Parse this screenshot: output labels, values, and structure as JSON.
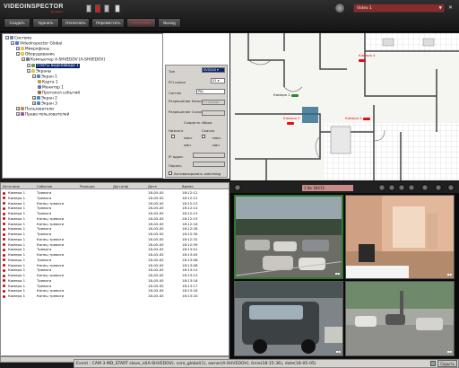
{
  "app": {
    "logo_main": "VIDEOINSPECTOR",
    "logo_sub": "GLOBAL"
  },
  "toolbar": {
    "buttons": [
      "Создать",
      "Удалить",
      "Отключить",
      "Переместить",
      "Настройки",
      "Выход"
    ],
    "active_index": 4,
    "video_select": "Video 1"
  },
  "tree": {
    "nodes": [
      {
        "label": "Система",
        "level": 0,
        "expander": "−",
        "icon": "system-icon"
      },
      {
        "label": "VideoInspector Global",
        "level": 1,
        "expander": "−",
        "icon": "server-icon"
      },
      {
        "label": "Микрофоны",
        "level": 2,
        "expander": "+",
        "icon": "folder-icon"
      },
      {
        "label": "Оборудование",
        "level": 2,
        "expander": "−",
        "icon": "folder-icon"
      },
      {
        "label": "Компьютер A-SHVEDOV [A-SHVEDOV]",
        "level": 3,
        "expander": "−",
        "icon": "computer-icon"
      },
      {
        "label": "Платы видеоввода 1",
        "level": 4,
        "expander": "−",
        "icon": "board-icon",
        "selected": true
      },
      {
        "label": "Экраны",
        "level": 4,
        "expander": "−",
        "icon": "folder-icon"
      },
      {
        "label": "Экран 1",
        "level": 5,
        "expander": "−",
        "icon": "screen-icon"
      },
      {
        "label": "Карта 1",
        "level": 6,
        "expander": "",
        "icon": "map-icon"
      },
      {
        "label": "Монитор 1",
        "level": 6,
        "expander": "",
        "icon": "monitor-icon"
      },
      {
        "label": "Протокол событий",
        "level": 6,
        "expander": "",
        "icon": "log-icon"
      },
      {
        "label": "Экран 2",
        "level": 5,
        "expander": "+",
        "icon": "screen-icon"
      },
      {
        "label": "Экран 3",
        "level": 5,
        "expander": "+",
        "icon": "screen-icon"
      },
      {
        "label": "Пользователи",
        "level": 2,
        "expander": "+",
        "icon": "users-icon"
      },
      {
        "label": "Права пользователей",
        "level": 2,
        "expander": "+",
        "icon": "rights-icon"
      }
    ]
  },
  "props": {
    "type_label": "Тип",
    "type_value": "SV5244",
    "pci_label": "PCI канал",
    "pci_value": "01",
    "signal_label": "Сигнал",
    "signal_value": "PAL",
    "res_low_label": "Разрешение Низкого",
    "res_low_value": "Стандарт",
    "res_high_label": "Разрешение Скачка",
    "res_high_value": "",
    "speed_label": "Скорость сбора",
    "low_label": "Низкого",
    "jump_label": "Скачка",
    "max_label": "макс",
    "min_label": "мин",
    "ip_label": "IP адрес",
    "password_label": "Пароль",
    "watchdog_label": "Активизировать watchdog"
  },
  "map": {
    "cameras": [
      {
        "label": "Камера 1",
        "color": "green"
      },
      {
        "label": "Камера 4",
        "color": "red"
      },
      {
        "label": "Камера 3",
        "color": "red"
      },
      {
        "label": "Камера 2",
        "color": "red"
      }
    ]
  },
  "log": {
    "columns": [
      "Источник",
      "Событие",
      "Реакция",
      "Доп.инф",
      "Дата",
      "Время"
    ],
    "rows": [
      [
        "Камера 1",
        "Тревога",
        "",
        "",
        "18-05-05",
        "18:12:12"
      ],
      [
        "Камера 1",
        "Тревога",
        "",
        "",
        "18-05-05",
        "18:12:12"
      ],
      [
        "Камера 1",
        "Конец тревоги",
        "",
        "",
        "18-05-05",
        "18:12:13"
      ],
      [
        "Камера 1",
        "Тревога",
        "",
        "",
        "18-05-05",
        "18:12:14"
      ],
      [
        "Камера 1",
        "Тревога",
        "",
        "",
        "18-05-05",
        "18:12:15"
      ],
      [
        "Камера 1",
        "Конец тревоги",
        "",
        "",
        "18-05-05",
        "18:12:15"
      ],
      [
        "Камера 1",
        "Конец тревоги",
        "",
        "",
        "18-05-05",
        "18:12:18"
      ],
      [
        "Камера 1",
        "Тревога",
        "",
        "",
        "18-05-05",
        "18:12:28"
      ],
      [
        "Камера 1",
        "Тревога",
        "",
        "",
        "18-05-05",
        "18:12:30"
      ],
      [
        "Камера 1",
        "Конец тревоги",
        "",
        "",
        "18-05-05",
        "18:12:32"
      ],
      [
        "Камера 1",
        "Конец тревоги",
        "",
        "",
        "18-05-05",
        "18:12:59"
      ],
      [
        "Камера 1",
        "Тревога",
        "",
        "",
        "18-05-05",
        "18:13:01"
      ],
      [
        "Камера 1",
        "Конец тревоги",
        "",
        "",
        "18-05-05",
        "18:13:05"
      ],
      [
        "Камера 1",
        "Тревога",
        "",
        "",
        "18-05-05",
        "18:13:06"
      ],
      [
        "Камера 1",
        "Конец тревоги",
        "",
        "",
        "18-05-05",
        "18:13:08"
      ],
      [
        "Камера 1",
        "Тревога",
        "",
        "",
        "18-05-05",
        "18:13:14"
      ],
      [
        "Камера 1",
        "Конец тревоги",
        "",
        "",
        "18-05-05",
        "18:13:15"
      ],
      [
        "Камера 1",
        "Тревога",
        "",
        "",
        "18-05-05",
        "18:13:16"
      ],
      [
        "Камера 1",
        "Тревога",
        "",
        "",
        "18-05-05",
        "18:13:17"
      ],
      [
        "Камера 1",
        "Конец тревоги",
        "",
        "",
        "18-05-05",
        "18:13:18"
      ],
      [
        "Камера 1",
        "Конец тревоги",
        "",
        "",
        "18-05-05",
        "18:13:20"
      ]
    ]
  },
  "video": {
    "title": "1 Вх 30415",
    "colors": {
      "active_border": "#2f7a2f"
    }
  },
  "status": {
    "text": "Event : CAM 3 MD_START slave_id(A-SHVEDOV), core_global(1), owner(A-SHVEDOV), time(18:15:36), date(18-05-05)",
    "button": "Скрыть"
  },
  "colors": {
    "accent_red": "#c22222",
    "selection_blue": "#0a246a",
    "panel_gray": "#d6d3ce"
  }
}
